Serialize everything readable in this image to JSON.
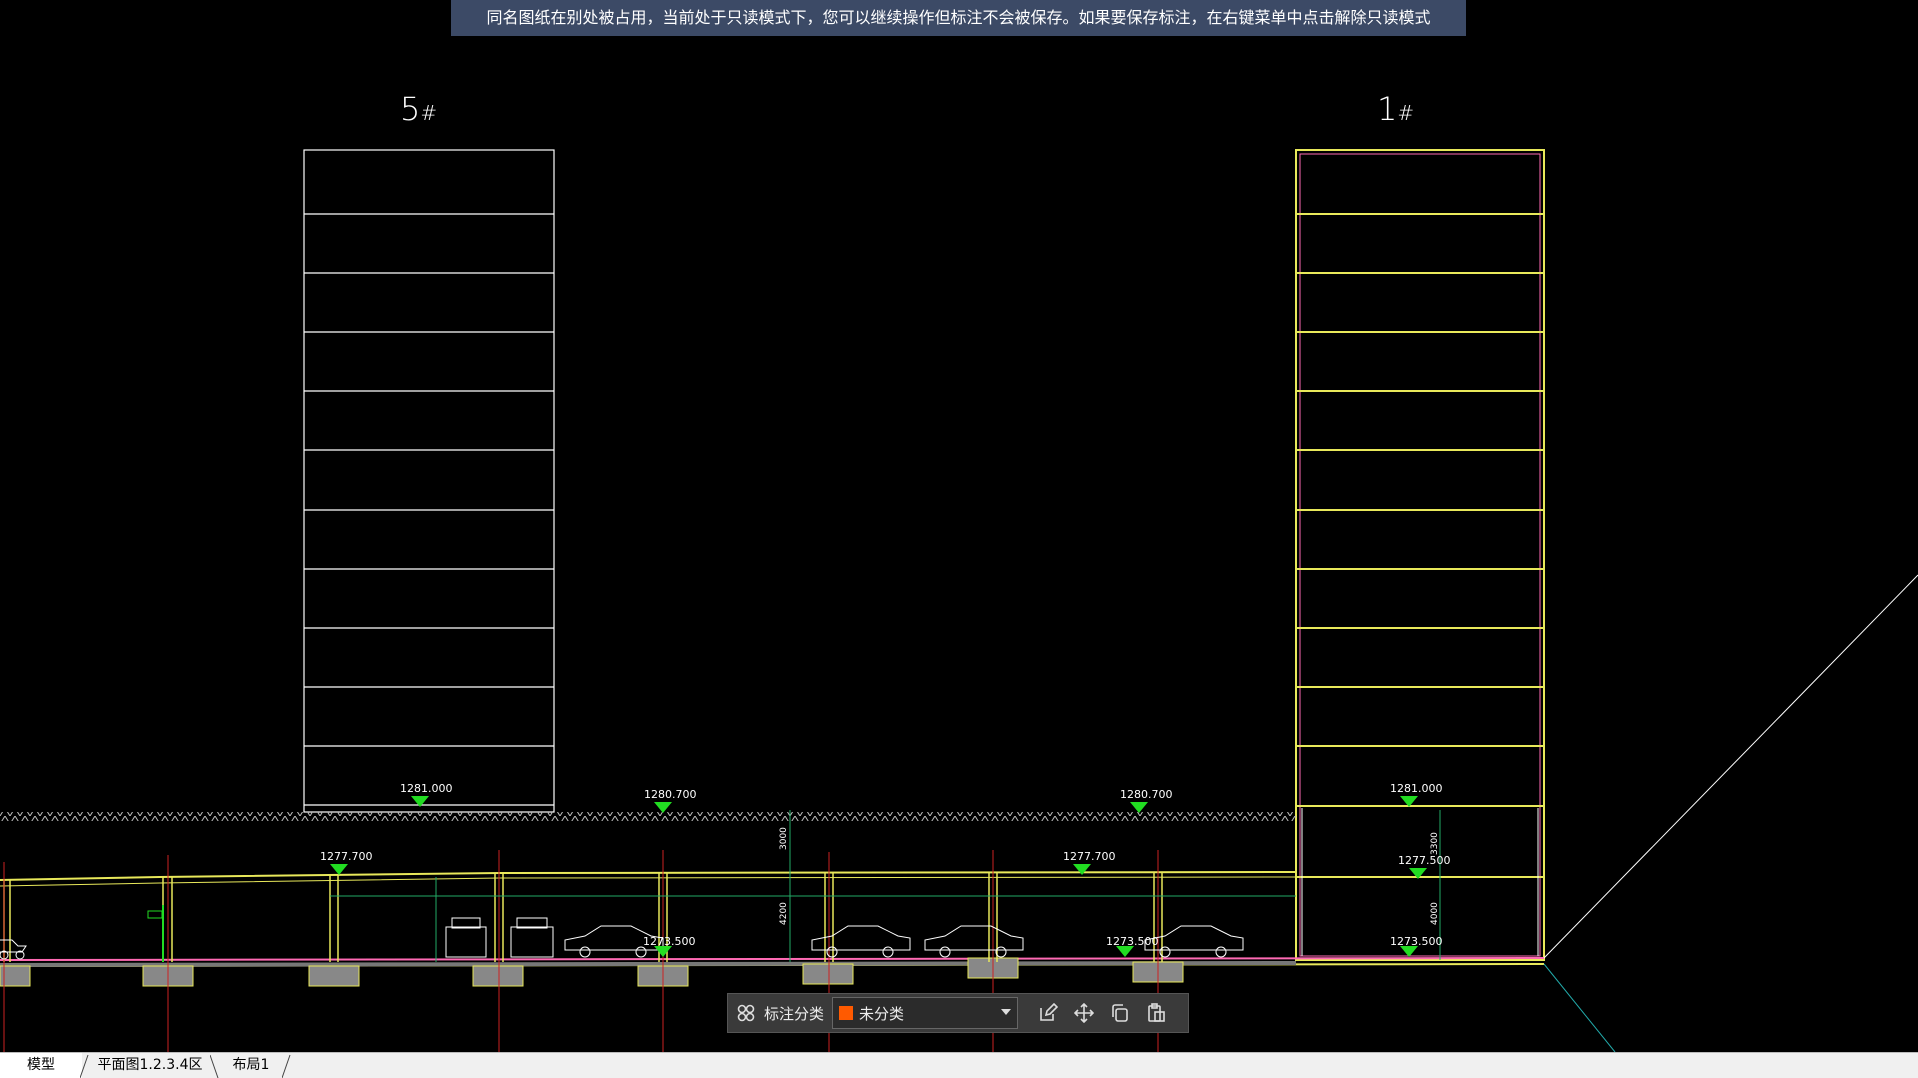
{
  "notice": "同名图纸在别处被占用，当前处于只读模式下，您可以继续操作但标注不会被保存。如果要保存标注，在右键菜单中点击解除只读模式",
  "drawing": {
    "buildings": [
      {
        "number": "5",
        "suffix": "#"
      },
      {
        "number": "1",
        "suffix": "#"
      }
    ],
    "elevations": [
      "1281.000",
      "1280.700",
      "1280.700",
      "1281.000",
      "1277.700",
      "1277.700",
      "1277.500",
      "1273.500",
      "1273.500",
      "1273.500"
    ],
    "dimensions": [
      "3000",
      "4200",
      "3300",
      "4000"
    ]
  },
  "toolbar": {
    "category_label": "标注分类",
    "category_value": "未分类",
    "category_color": "#ff5a00",
    "icons": [
      "grid-icon",
      "edit-icon",
      "move-icon",
      "copy-icon",
      "paste-icon"
    ]
  },
  "tabs": [
    "模型",
    "平面图1.2.3.4区",
    "布局1"
  ],
  "colors": {
    "background": "#000000",
    "wall": "#e8e85a",
    "slab": "#ff6ab4",
    "grid": "#cc2222",
    "marker": "#22dd22"
  }
}
